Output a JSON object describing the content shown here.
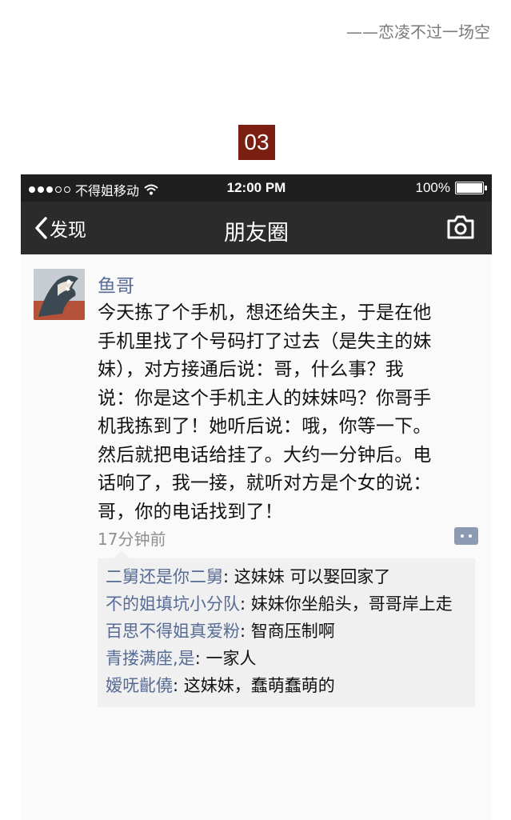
{
  "header": {
    "signature": "——恋凌不过一场空",
    "badge": "03"
  },
  "statusbar": {
    "carrier": "不得姐移动",
    "time": "12:00 PM",
    "battery": "100%",
    "battery_level": 1.0
  },
  "nav": {
    "back_label": "发现",
    "title": "朋友圈"
  },
  "post": {
    "author": "鱼哥",
    "lines": [
      "今天拣了个手机，想还给失主，于是在他",
      "手机里找了个号码打了过去（是失主的妹",
      "妹），对方接通后说：哥，什么事？我",
      "说：你是这个手机主人的妹妹吗？你哥手",
      "机我拣到了！她听后说：哦，你等一下。",
      "然后就把电话给挂了。大约一分钟后。电",
      "话响了，我一接，就听对方是个女的说：",
      "哥，你的电话找到了！"
    ],
    "time": "17分钟前"
  },
  "comments": [
    {
      "name": "二舅还是你二舅",
      "text": ": 这妹妹 可以娶回家了"
    },
    {
      "name": "不的姐填坑小分队",
      "text": ": 妹妹你坐船头，哥哥岸上走"
    },
    {
      "name": "百思不得姐真爱粉",
      "text": ": 智商压制啊"
    },
    {
      "name": "青搂满座,是",
      "text": ": 一家人"
    },
    {
      "name": "嫒呒齔僥",
      "text": ": 这妹妹，蠢萌蠢萌的"
    }
  ],
  "colors": {
    "badge_bg": "#7a1f12",
    "statusbar_bg": "#1f1f1f",
    "navbar_bg": "#2b2b2b",
    "name_link": "#576b95",
    "comment_bg": "#f0f0f0"
  }
}
